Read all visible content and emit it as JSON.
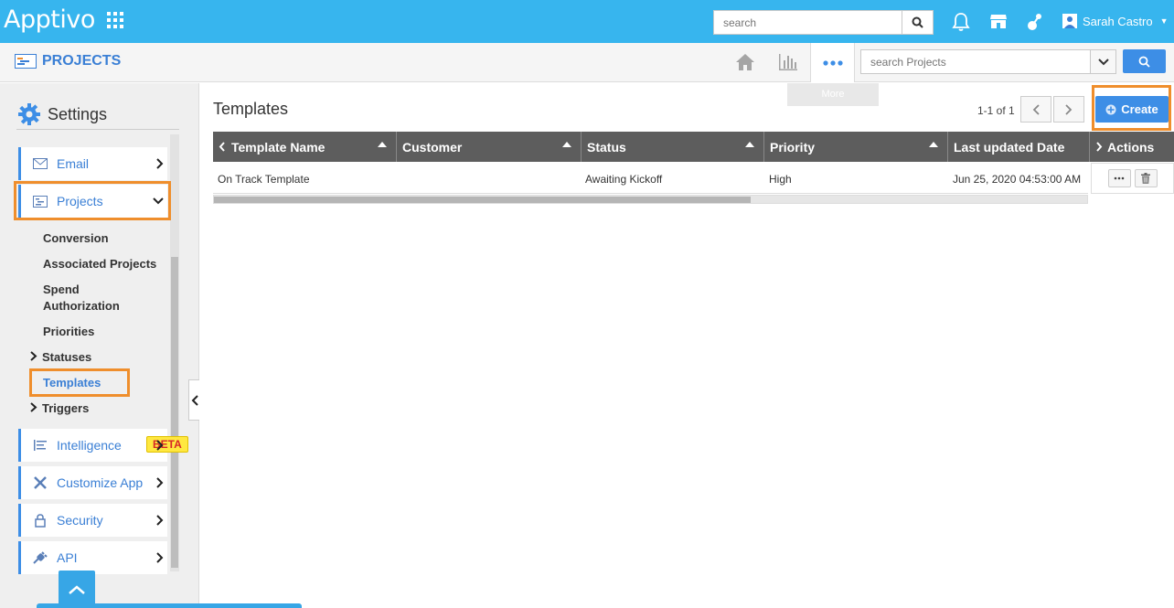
{
  "header": {
    "logo": "Apptivo",
    "search_placeholder": "search",
    "user_name": "Sarah Castro"
  },
  "appbar": {
    "title": "PROJECTS",
    "more_tooltip": "More",
    "search_placeholder": "search Projects"
  },
  "sidebar": {
    "title": "Settings",
    "items": [
      {
        "label": "Email"
      },
      {
        "label": "Projects"
      },
      {
        "label": "Intelligence",
        "badge": "BETA"
      },
      {
        "label": "Customize App"
      },
      {
        "label": "Security"
      },
      {
        "label": "API"
      }
    ],
    "sub_items": [
      "Conversion",
      "Associated Projects",
      "Spend Authorization",
      "Priorities",
      "Statuses",
      "Templates",
      "Triggers"
    ]
  },
  "main": {
    "title": "Templates",
    "pager": "1-1 of 1",
    "create_label": "Create",
    "columns": [
      "Template Name",
      "Customer",
      "Status",
      "Priority",
      "Last updated Date",
      "Actions"
    ],
    "rows": [
      {
        "template_name": "On Track Template",
        "customer": "",
        "status": "Awaiting Kickoff",
        "priority": "High",
        "last_updated": "Jun 25, 2020 04:53:00 AM"
      }
    ]
  },
  "colors": {
    "topbar": "#37b5ee",
    "accent": "#3d8ee6",
    "highlight": "#ef8e2c",
    "table_header": "#5d5d5d"
  }
}
